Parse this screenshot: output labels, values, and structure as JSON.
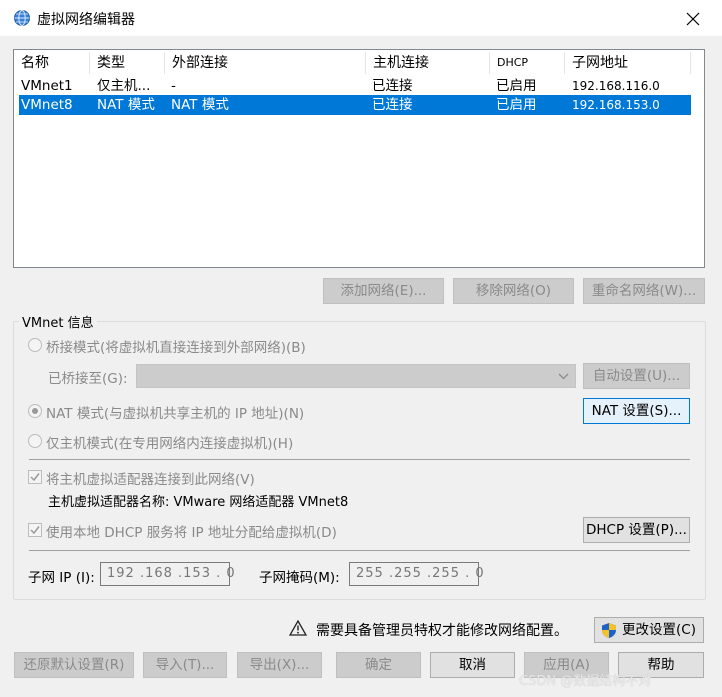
{
  "window": {
    "title": "虚拟网络编辑器",
    "icon": "network-globe-icon"
  },
  "table": {
    "columns": [
      "名称",
      "类型",
      "外部连接",
      "主机连接",
      "DHCP",
      "子网地址"
    ],
    "rows": [
      {
        "name": "VMnet1",
        "type": "仅主机...",
        "external": "-",
        "host": "已连接",
        "dhcp": "已启用",
        "subnet": "192.168.116.0",
        "selected": false
      },
      {
        "name": "VMnet8",
        "type": "NAT 模式",
        "external": "NAT 模式",
        "host": "已连接",
        "dhcp": "已启用",
        "subnet": "192.168.153.0",
        "selected": true
      }
    ]
  },
  "list_buttons": {
    "add": "添加网络(E)...",
    "remove": "移除网络(O)",
    "rename": "重命名网络(W)..."
  },
  "vmnet_info": {
    "group_label": "VMnet 信息",
    "bridge_radio": "桥接模式(将虚拟机直接连接到外部网络)(B)",
    "bridged_to_label": "已桥接至(G):",
    "bridged_to_value": "",
    "auto_settings": "自动设置(U)...",
    "nat_radio": "NAT 模式(与虚拟机共享主机的 IP 地址)(N)",
    "nat_settings": "NAT 设置(S)...",
    "hostonly_radio": "仅主机模式(在专用网络内连接虚拟机)(H)",
    "connect_adapter_check": "将主机虚拟适配器连接到此网络(V)",
    "adapter_name_line": "主机虚拟适配器名称: VMware 网络适配器 VMnet8",
    "dhcp_check": "使用本地 DHCP 服务将 IP 地址分配给虚拟机(D)",
    "dhcp_settings": "DHCP 设置(P)...",
    "subnet_ip_label": "子网 IP (I):",
    "subnet_ip_value": "192 .168 .153 .  0",
    "subnet_mask_label": "子网掩码(M):",
    "subnet_mask_value": "255 .255 .255 .  0"
  },
  "admin": {
    "warning_text": "需要具备管理员特权才能修改网络配置。",
    "change_settings": "更改设置(C)"
  },
  "footer_buttons": {
    "restore": "还原默认设置(R)",
    "import": "导入(T)...",
    "export": "导出(X)...",
    "ok": "确定",
    "cancel": "取消",
    "apply": "应用(A)",
    "help": "帮助"
  },
  "watermark": "CSDN @数据结构不对",
  "colors": {
    "selection": "#0078d7",
    "dialog_bg": "#f0f0f0",
    "disabled_text": "#8a8a8a"
  }
}
